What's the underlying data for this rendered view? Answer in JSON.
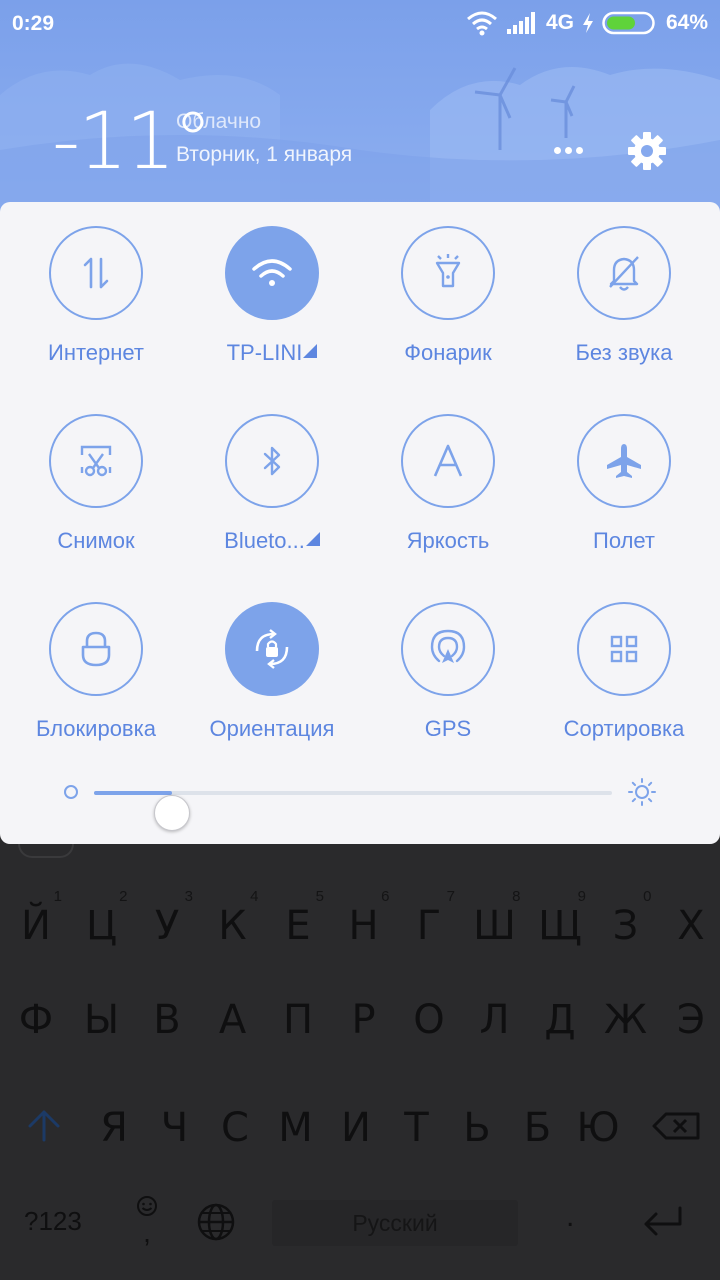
{
  "status_bar": {
    "time": "0:29",
    "network": "4G",
    "battery": "64%",
    "battery_level": 0.64
  },
  "weather": {
    "temperature": "-11°",
    "condition": "Облачно",
    "date": "Вторник, 1 января"
  },
  "quick_settings": {
    "tiles": [
      {
        "label": "Интернет",
        "icon": "data-transfer-icon",
        "active": false
      },
      {
        "label": "TP-LINI",
        "icon": "wifi-icon",
        "active": true,
        "has_dropdown": true
      },
      {
        "label": "Фонарик",
        "icon": "flashlight-icon",
        "active": false
      },
      {
        "label": "Без звука",
        "icon": "bell-off-icon",
        "active": false
      },
      {
        "label": "Снимок",
        "icon": "screenshot-scissors-icon",
        "active": false
      },
      {
        "label": "Blueto...",
        "icon": "bluetooth-icon",
        "active": false,
        "has_dropdown": true
      },
      {
        "label": "Яркость",
        "icon": "brightness-auto-icon",
        "active": false
      },
      {
        "label": "Полет",
        "icon": "airplane-icon",
        "active": false
      },
      {
        "label": "Блокировка",
        "icon": "lock-icon",
        "active": false
      },
      {
        "label": "Ориентация",
        "icon": "rotation-lock-icon",
        "active": true
      },
      {
        "label": "GPS",
        "icon": "gps-icon",
        "active": false
      },
      {
        "label": "Сортировка",
        "icon": "grid-icon",
        "active": false
      }
    ],
    "brightness": 0.15
  },
  "keyboard": {
    "row1": [
      {
        "k": "Й",
        "n": "1"
      },
      {
        "k": "Ц",
        "n": "2"
      },
      {
        "k": "У",
        "n": "3"
      },
      {
        "k": "К",
        "n": "4"
      },
      {
        "k": "Е",
        "n": "5"
      },
      {
        "k": "Н",
        "n": "6"
      },
      {
        "k": "Г",
        "n": "7"
      },
      {
        "k": "Ш",
        "n": "8"
      },
      {
        "k": "Щ",
        "n": "9"
      },
      {
        "k": "З",
        "n": "0"
      },
      {
        "k": "Х",
        "n": ""
      }
    ],
    "row2": [
      "Ф",
      "Ы",
      "В",
      "А",
      "П",
      "Р",
      "О",
      "Л",
      "Д",
      "Ж",
      "Э"
    ],
    "row3": [
      "Я",
      "Ч",
      "С",
      "М",
      "И",
      "Т",
      "Ь",
      "Б",
      "Ю"
    ],
    "symbols_label": "?123",
    "comma_label": ",",
    "space_label": "Русский",
    "period_label": ".",
    "accent_color": "#1c3a66"
  }
}
